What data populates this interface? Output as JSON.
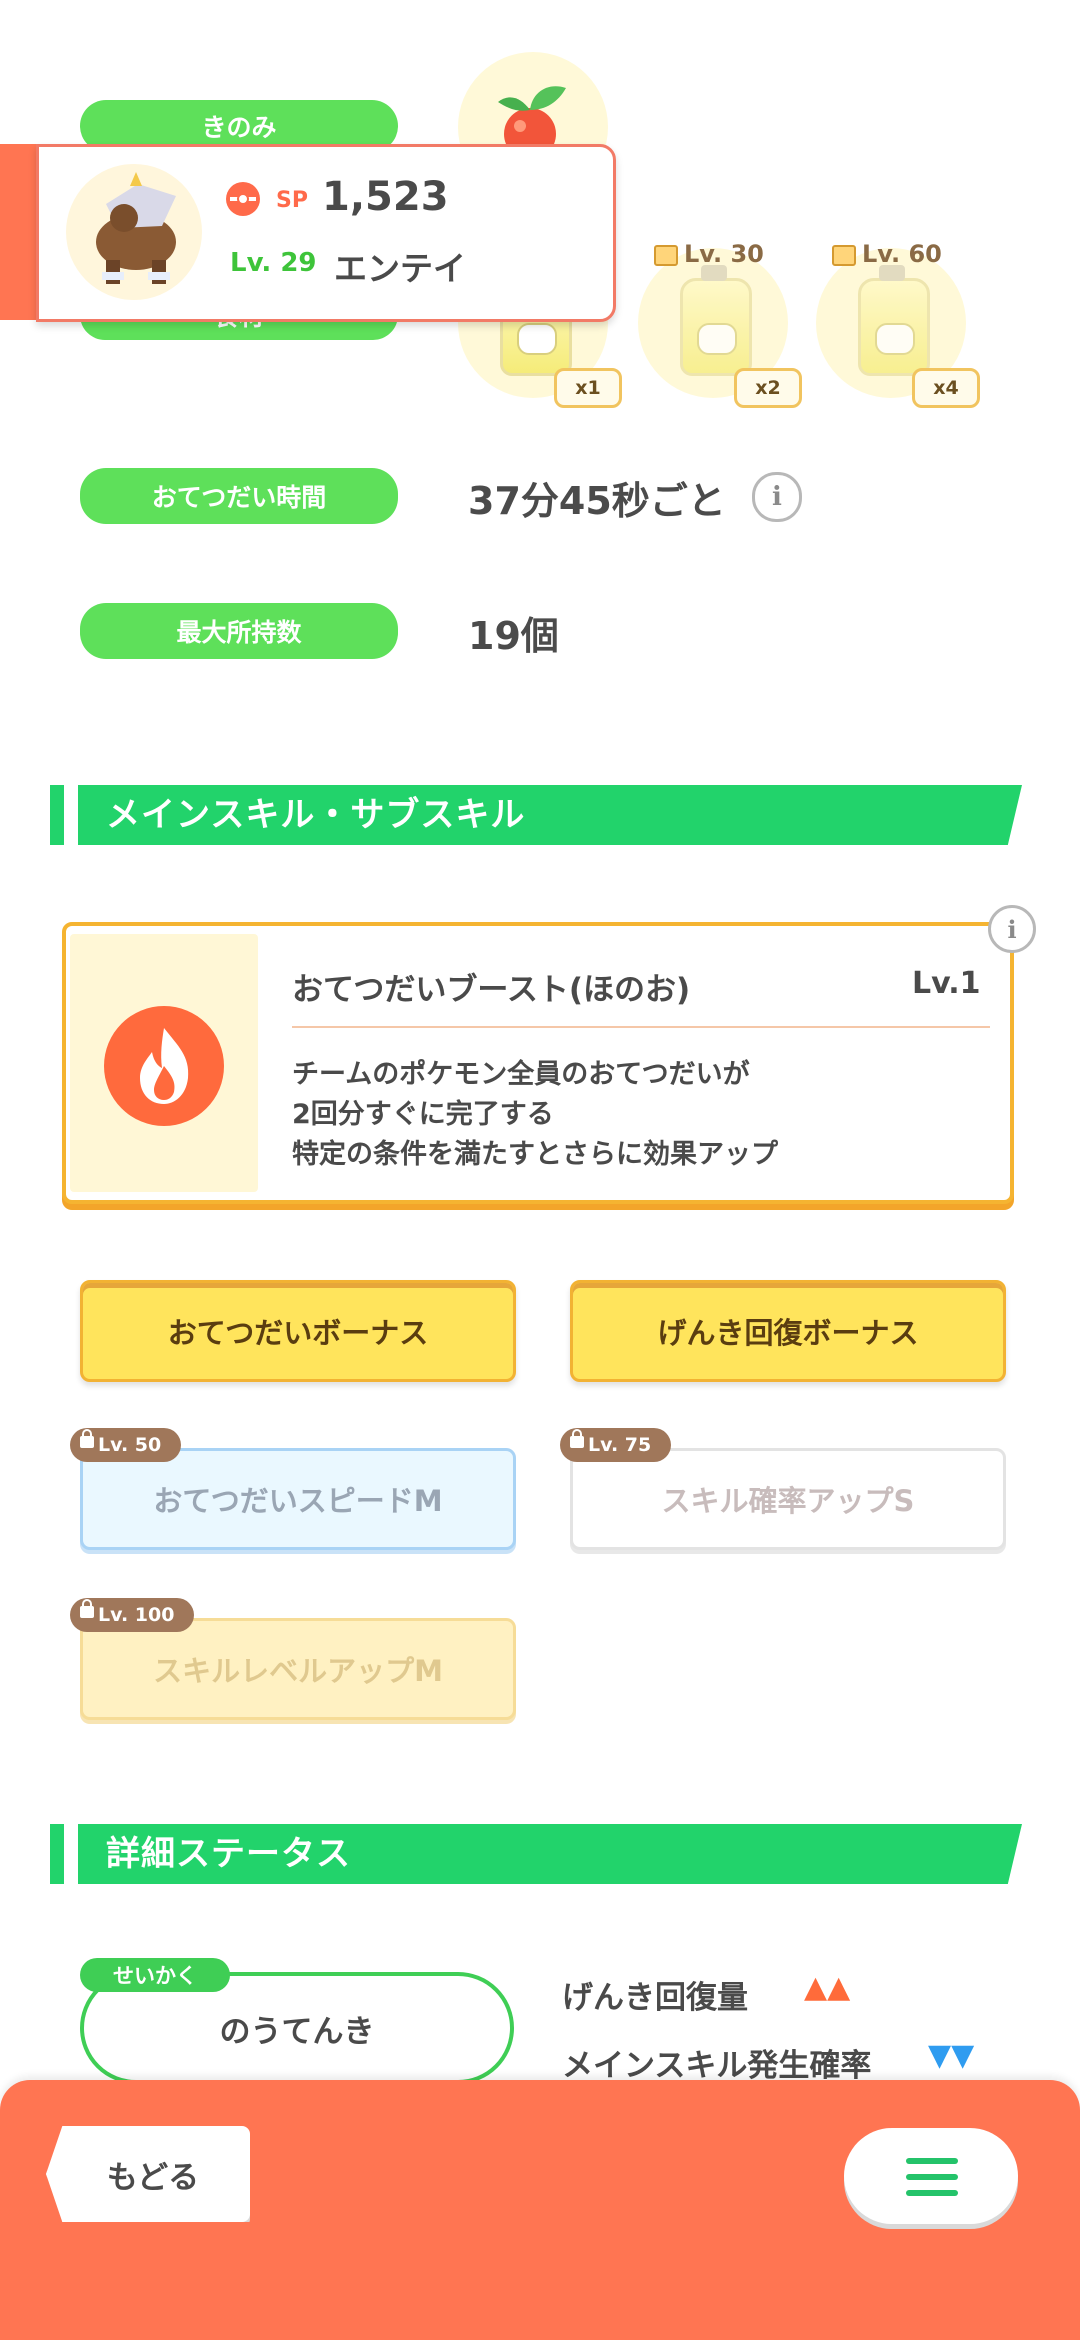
{
  "ingredients": {
    "label_top": "きのみ",
    "label_hidden": "食材",
    "items": [
      {
        "qty": "x1",
        "lock": ""
      },
      {
        "qty": "x2",
        "lock": "Lv. 30"
      },
      {
        "qty": "x4",
        "lock": "Lv. 60"
      }
    ]
  },
  "pokemon_card": {
    "sp_prefix": "SP",
    "sp_value": "1,523",
    "level": "Lv. 29",
    "name": "エンテイ"
  },
  "help_time": {
    "label": "おてつだい時間",
    "value": "37分45秒ごと"
  },
  "max_carry": {
    "label": "最大所持数",
    "value": "19個"
  },
  "skills_section": {
    "title": "メインスキル・サブスキル"
  },
  "main_skill": {
    "name": "おてつだいブースト(ほのお)",
    "level": "Lv.1",
    "desc_line1": "チームのポケモン全員のおてつだいが",
    "desc_line2": "2回分すぐに完了する",
    "desc_line3": "特定の条件を満たすとさらに効果アップ"
  },
  "sub_skills": [
    {
      "label": "おてつだいボーナス",
      "lock": ""
    },
    {
      "label": "げんき回復ボーナス",
      "lock": ""
    },
    {
      "label": "おてつだいスピードM",
      "lock": "Lv. 50"
    },
    {
      "label": "スキル確率アップS",
      "lock": "Lv. 75"
    },
    {
      "label": "スキルレベルアップM",
      "lock": "Lv. 100"
    }
  ],
  "details_section": {
    "title": "詳細ステータス"
  },
  "nature": {
    "tag": "せいかく",
    "value": "のうてんき",
    "up_label": "げんき回復量",
    "up_marks": "▲▲",
    "down_label": "メインスキル発生確率",
    "down_marks": "▼▼"
  },
  "footer": {
    "back_label": "もどる"
  },
  "colors": {
    "green": "#5ee05a",
    "section_green": "#22d36b",
    "footer": "#ff7552",
    "fire_skill": "#ff6a3d",
    "up": "#ff6b3a",
    "down": "#2f9cf0"
  }
}
